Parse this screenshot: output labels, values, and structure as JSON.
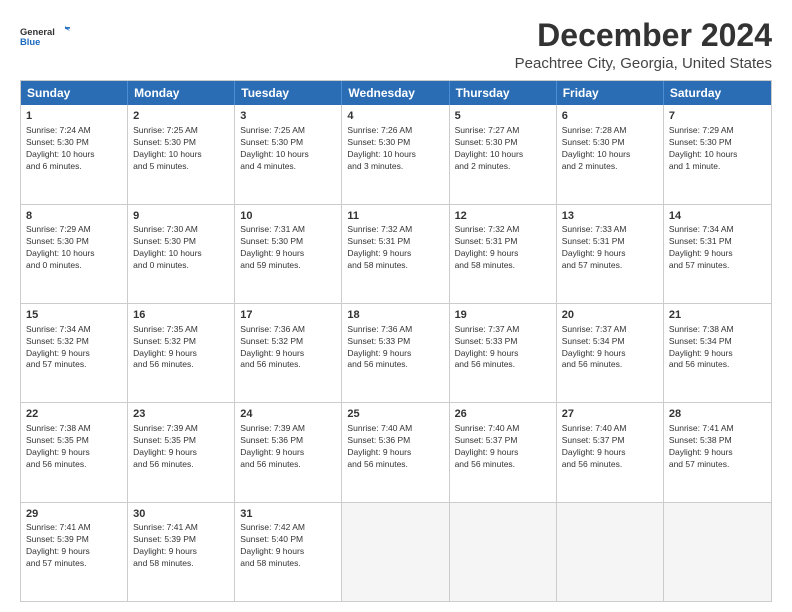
{
  "logo": {
    "line1": "General",
    "line2": "Blue"
  },
  "title": "December 2024",
  "subtitle": "Peachtree City, Georgia, United States",
  "days": [
    "Sunday",
    "Monday",
    "Tuesday",
    "Wednesday",
    "Thursday",
    "Friday",
    "Saturday"
  ],
  "weeks": [
    [
      {
        "num": "1",
        "info": "Sunrise: 7:24 AM\nSunset: 5:30 PM\nDaylight: 10 hours\nand 6 minutes."
      },
      {
        "num": "2",
        "info": "Sunrise: 7:25 AM\nSunset: 5:30 PM\nDaylight: 10 hours\nand 5 minutes."
      },
      {
        "num": "3",
        "info": "Sunrise: 7:25 AM\nSunset: 5:30 PM\nDaylight: 10 hours\nand 4 minutes."
      },
      {
        "num": "4",
        "info": "Sunrise: 7:26 AM\nSunset: 5:30 PM\nDaylight: 10 hours\nand 3 minutes."
      },
      {
        "num": "5",
        "info": "Sunrise: 7:27 AM\nSunset: 5:30 PM\nDaylight: 10 hours\nand 2 minutes."
      },
      {
        "num": "6",
        "info": "Sunrise: 7:28 AM\nSunset: 5:30 PM\nDaylight: 10 hours\nand 2 minutes."
      },
      {
        "num": "7",
        "info": "Sunrise: 7:29 AM\nSunset: 5:30 PM\nDaylight: 10 hours\nand 1 minute."
      }
    ],
    [
      {
        "num": "8",
        "info": "Sunrise: 7:29 AM\nSunset: 5:30 PM\nDaylight: 10 hours\nand 0 minutes."
      },
      {
        "num": "9",
        "info": "Sunrise: 7:30 AM\nSunset: 5:30 PM\nDaylight: 10 hours\nand 0 minutes."
      },
      {
        "num": "10",
        "info": "Sunrise: 7:31 AM\nSunset: 5:30 PM\nDaylight: 9 hours\nand 59 minutes."
      },
      {
        "num": "11",
        "info": "Sunrise: 7:32 AM\nSunset: 5:31 PM\nDaylight: 9 hours\nand 58 minutes."
      },
      {
        "num": "12",
        "info": "Sunrise: 7:32 AM\nSunset: 5:31 PM\nDaylight: 9 hours\nand 58 minutes."
      },
      {
        "num": "13",
        "info": "Sunrise: 7:33 AM\nSunset: 5:31 PM\nDaylight: 9 hours\nand 57 minutes."
      },
      {
        "num": "14",
        "info": "Sunrise: 7:34 AM\nSunset: 5:31 PM\nDaylight: 9 hours\nand 57 minutes."
      }
    ],
    [
      {
        "num": "15",
        "info": "Sunrise: 7:34 AM\nSunset: 5:32 PM\nDaylight: 9 hours\nand 57 minutes."
      },
      {
        "num": "16",
        "info": "Sunrise: 7:35 AM\nSunset: 5:32 PM\nDaylight: 9 hours\nand 56 minutes."
      },
      {
        "num": "17",
        "info": "Sunrise: 7:36 AM\nSunset: 5:32 PM\nDaylight: 9 hours\nand 56 minutes."
      },
      {
        "num": "18",
        "info": "Sunrise: 7:36 AM\nSunset: 5:33 PM\nDaylight: 9 hours\nand 56 minutes."
      },
      {
        "num": "19",
        "info": "Sunrise: 7:37 AM\nSunset: 5:33 PM\nDaylight: 9 hours\nand 56 minutes."
      },
      {
        "num": "20",
        "info": "Sunrise: 7:37 AM\nSunset: 5:34 PM\nDaylight: 9 hours\nand 56 minutes."
      },
      {
        "num": "21",
        "info": "Sunrise: 7:38 AM\nSunset: 5:34 PM\nDaylight: 9 hours\nand 56 minutes."
      }
    ],
    [
      {
        "num": "22",
        "info": "Sunrise: 7:38 AM\nSunset: 5:35 PM\nDaylight: 9 hours\nand 56 minutes."
      },
      {
        "num": "23",
        "info": "Sunrise: 7:39 AM\nSunset: 5:35 PM\nDaylight: 9 hours\nand 56 minutes."
      },
      {
        "num": "24",
        "info": "Sunrise: 7:39 AM\nSunset: 5:36 PM\nDaylight: 9 hours\nand 56 minutes."
      },
      {
        "num": "25",
        "info": "Sunrise: 7:40 AM\nSunset: 5:36 PM\nDaylight: 9 hours\nand 56 minutes."
      },
      {
        "num": "26",
        "info": "Sunrise: 7:40 AM\nSunset: 5:37 PM\nDaylight: 9 hours\nand 56 minutes."
      },
      {
        "num": "27",
        "info": "Sunrise: 7:40 AM\nSunset: 5:37 PM\nDaylight: 9 hours\nand 56 minutes."
      },
      {
        "num": "28",
        "info": "Sunrise: 7:41 AM\nSunset: 5:38 PM\nDaylight: 9 hours\nand 57 minutes."
      }
    ],
    [
      {
        "num": "29",
        "info": "Sunrise: 7:41 AM\nSunset: 5:39 PM\nDaylight: 9 hours\nand 57 minutes."
      },
      {
        "num": "30",
        "info": "Sunrise: 7:41 AM\nSunset: 5:39 PM\nDaylight: 9 hours\nand 58 minutes."
      },
      {
        "num": "31",
        "info": "Sunrise: 7:42 AM\nSunset: 5:40 PM\nDaylight: 9 hours\nand 58 minutes."
      },
      {
        "num": "",
        "info": ""
      },
      {
        "num": "",
        "info": ""
      },
      {
        "num": "",
        "info": ""
      },
      {
        "num": "",
        "info": ""
      }
    ]
  ]
}
